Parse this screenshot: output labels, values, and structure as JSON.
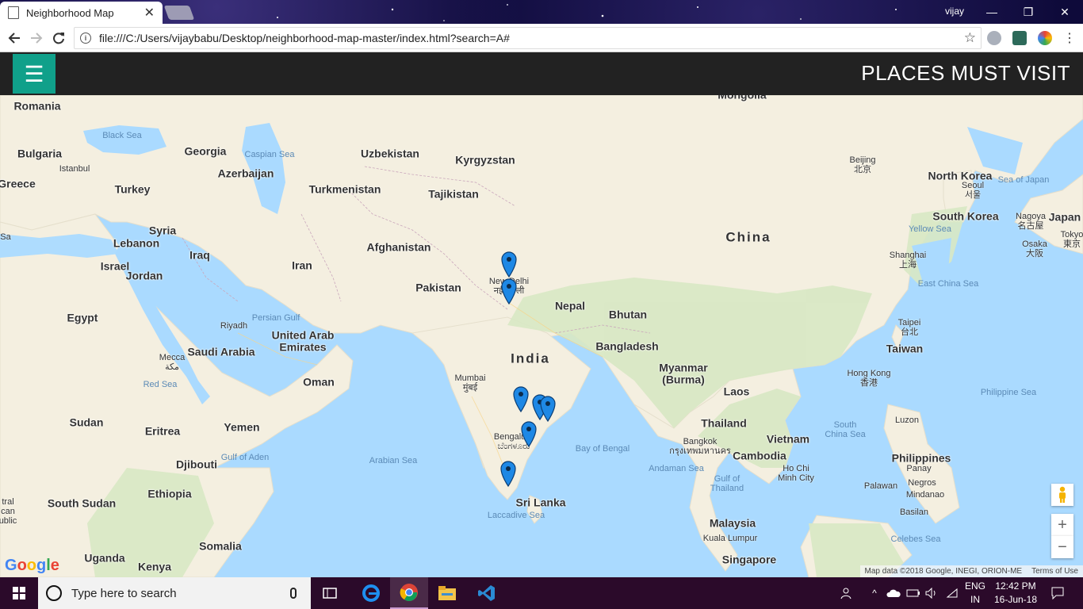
{
  "browser": {
    "tab_title": "Neighborhood Map",
    "tab_close": "✕",
    "user_name": "vijay",
    "url": "file:///C:/Users/vijaybabu/Desktop/neighborhood-map-master/index.html?search=A#",
    "window_buttons": [
      "—",
      "❐",
      "✕"
    ]
  },
  "app": {
    "menu_icon": "☰",
    "title": "PLACES MUST VISIT"
  },
  "map": {
    "labels": {
      "countries": [
        {
          "name": "Romania"
        },
        {
          "name": "Bulgaria"
        },
        {
          "name": "Greece"
        },
        {
          "name": "Turkey"
        },
        {
          "name": "Georgia"
        },
        {
          "name": "Azerbaijan"
        },
        {
          "name": "Uzbekistan"
        },
        {
          "name": "Kyrgyzstan"
        },
        {
          "name": "Turkmenistan"
        },
        {
          "name": "Tajikistan"
        },
        {
          "name": "Syria"
        },
        {
          "name": "Lebanon"
        },
        {
          "name": "Israel"
        },
        {
          "name": "Jordan"
        },
        {
          "name": "Iraq"
        },
        {
          "name": "Iran"
        },
        {
          "name": "Afghanistan"
        },
        {
          "name": "Pakistan"
        },
        {
          "name": "Egypt"
        },
        {
          "name": "Saudi Arabia"
        },
        {
          "name": "United Arab\nEmirates"
        },
        {
          "name": "Oman"
        },
        {
          "name": "Nepal"
        },
        {
          "name": "Bhutan"
        },
        {
          "name": "Bangladesh"
        },
        {
          "name": "India"
        },
        {
          "name": "Myanmar\n(Burma)"
        },
        {
          "name": "Laos"
        },
        {
          "name": "Thailand"
        },
        {
          "name": "Vietnam"
        },
        {
          "name": "Cambodia"
        },
        {
          "name": "Sudan"
        },
        {
          "name": "Eritrea"
        },
        {
          "name": "Yemen"
        },
        {
          "name": "Djibouti"
        },
        {
          "name": "Ethiopia"
        },
        {
          "name": "South Sudan"
        },
        {
          "name": "Somalia"
        },
        {
          "name": "Uganda"
        },
        {
          "name": "Kenya"
        },
        {
          "name": "Sri Lanka"
        },
        {
          "name": "Malaysia"
        },
        {
          "name": "Singapore"
        },
        {
          "name": "China"
        },
        {
          "name": "Mongolia"
        },
        {
          "name": "North Korea"
        },
        {
          "name": "South Korea"
        },
        {
          "name": "Japan"
        },
        {
          "name": "Taiwan"
        },
        {
          "name": "Philippines"
        }
      ],
      "seas": [
        "Black Sea",
        "Caspian Sea",
        "Persian Gulf",
        "Red Sea",
        "Gulf of Aden",
        "Arabian Sea",
        "Bay of Bengal",
        "Laccadive Sea",
        "Andaman Sea",
        "Gulf of\nThailand",
        "South\nChina Sea",
        "Philippine Sea",
        "East China Sea",
        "Yellow Sea",
        "Sea of Japan",
        "Celebes Sea"
      ],
      "cities": [
        "Istanbul",
        "Riyadh",
        "Mecca\nمكة",
        "Mumbai\nमुंबई",
        "New Delhi\nनई दिल्ली",
        "Bengaluru\nಬೆಂಗಳೂರು",
        "Bangkok\nกรุงเทพมหานคร",
        "Ho Chi\nMinh City",
        "Kuala Lumpur",
        "Hong Kong\n香港",
        "Taipei\n台北",
        "Shanghai\n上海",
        "Beijing\n北京",
        "Seoul\n서울",
        "Nagoya\n名古屋",
        "Osaka\n大阪",
        "Tokyo\n東京",
        "Luzon",
        "Panay",
        "Negros",
        "Mindanao",
        "Palawan",
        "Basilan",
        "Sa",
        "tral\ncan\nublic"
      ]
    },
    "markers_count": 7,
    "google_logo": "Google",
    "attribution": "Map data ©2018 Google, INEGI, ORION-ME",
    "terms": "Terms of Use",
    "zoom_in": "+",
    "zoom_out": "−"
  },
  "taskbar": {
    "search_placeholder": "Type here to search",
    "lang_top": "ENG",
    "lang_bottom": "IN",
    "time": "12:42 PM",
    "date": "16-Jun-18"
  }
}
